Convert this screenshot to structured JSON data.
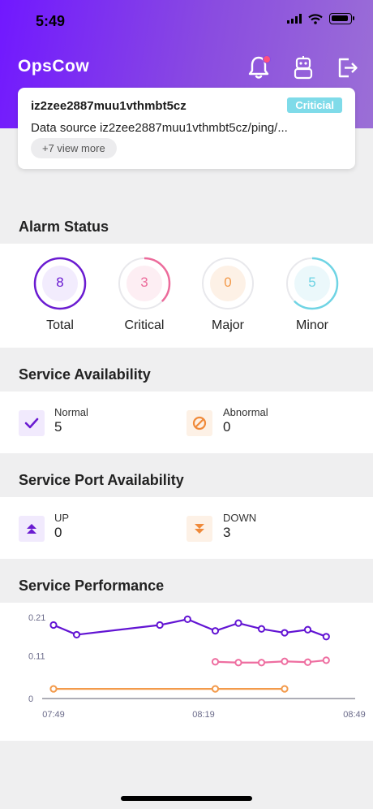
{
  "status_bar": {
    "time": "5:49"
  },
  "header": {
    "app_name": "OpsCow",
    "icons": [
      "bell-icon",
      "robot-icon",
      "logout-icon"
    ]
  },
  "alert": {
    "host": "iz2zee2887muu1vthmbt5cz",
    "badge": "Criticial",
    "message": "Data source iz2zee2887muu1vthmbt5cz/ping/...",
    "more": "+7 view more"
  },
  "alarm_status": {
    "title": "Alarm Status",
    "items": [
      {
        "label": "Total",
        "value": "8",
        "fraction": 1.0,
        "color": "#6a1bd1",
        "fill": "#f2ecfd"
      },
      {
        "label": "Critical",
        "value": "3",
        "fraction": 0.375,
        "color": "#ec6b9b",
        "fill": "#fdeef3"
      },
      {
        "label": "Major",
        "value": "0",
        "fraction": 0,
        "color": "#f39a4b",
        "fill": "#fdf1e6"
      },
      {
        "label": "Minor",
        "value": "5",
        "fraction": 0.625,
        "color": "#6fd4e4",
        "fill": "#ebf8fb"
      }
    ]
  },
  "service_availability": {
    "title": "Service Availability",
    "normal_label": "Normal",
    "normal_value": "5",
    "abnormal_label": "Abnormal",
    "abnormal_value": "0"
  },
  "port_availability": {
    "title": "Service Port Availability",
    "up_label": "UP",
    "up_value": "0",
    "down_label": "DOWN",
    "down_value": "3"
  },
  "performance": {
    "title": "Service Performance"
  },
  "chart_data": {
    "type": "line",
    "x_ticks": [
      "07:49",
      "08:19",
      "08:49"
    ],
    "y_ticks": [
      "0",
      "0.11",
      "0.21"
    ],
    "ylim": [
      0,
      0.21
    ],
    "xlim": [
      0,
      60
    ],
    "series": [
      {
        "color": "#6214d3",
        "x": [
          0,
          5,
          23,
          29,
          35,
          40,
          45,
          50,
          55,
          59
        ],
        "values": [
          0.19,
          0.165,
          0.19,
          0.205,
          0.175,
          0.195,
          0.18,
          0.17,
          0.178,
          0.16
        ]
      },
      {
        "color": "#ee6ea0",
        "x": [
          35,
          40,
          45,
          50,
          55,
          59
        ],
        "values": [
          0.095,
          0.093,
          0.093,
          0.096,
          0.094,
          0.099
        ]
      },
      {
        "color": "#f39a4b",
        "x": [
          0,
          35,
          50
        ],
        "values": [
          0.025,
          0.025,
          0.025
        ]
      }
    ]
  }
}
